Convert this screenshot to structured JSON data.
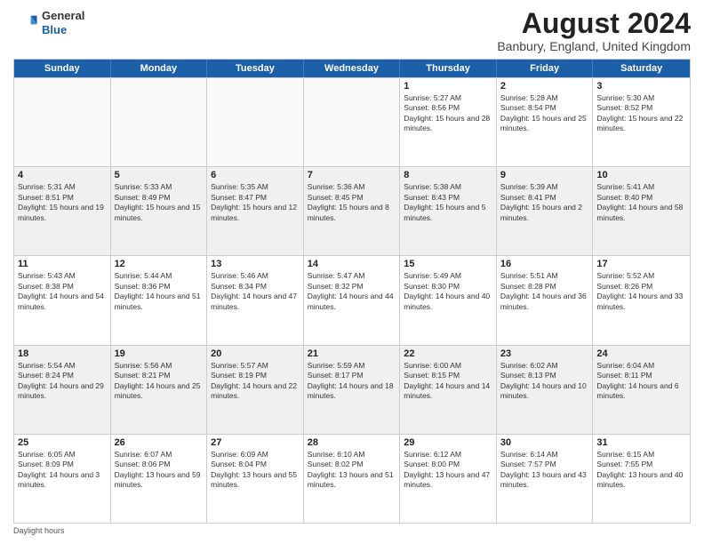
{
  "header": {
    "logo_general": "General",
    "logo_blue": "Blue",
    "month_title": "August 2024",
    "location": "Banbury, England, United Kingdom"
  },
  "days_of_week": [
    "Sunday",
    "Monday",
    "Tuesday",
    "Wednesday",
    "Thursday",
    "Friday",
    "Saturday"
  ],
  "weeks": [
    [
      {
        "day": "",
        "empty": true
      },
      {
        "day": "",
        "empty": true
      },
      {
        "day": "",
        "empty": true
      },
      {
        "day": "",
        "empty": true
      },
      {
        "day": "1",
        "sunrise": "5:27 AM",
        "sunset": "8:56 PM",
        "daylight": "15 hours and 28 minutes."
      },
      {
        "day": "2",
        "sunrise": "5:28 AM",
        "sunset": "8:54 PM",
        "daylight": "15 hours and 25 minutes."
      },
      {
        "day": "3",
        "sunrise": "5:30 AM",
        "sunset": "8:52 PM",
        "daylight": "15 hours and 22 minutes."
      }
    ],
    [
      {
        "day": "4",
        "sunrise": "5:31 AM",
        "sunset": "8:51 PM",
        "daylight": "15 hours and 19 minutes."
      },
      {
        "day": "5",
        "sunrise": "5:33 AM",
        "sunset": "8:49 PM",
        "daylight": "15 hours and 15 minutes."
      },
      {
        "day": "6",
        "sunrise": "5:35 AM",
        "sunset": "8:47 PM",
        "daylight": "15 hours and 12 minutes."
      },
      {
        "day": "7",
        "sunrise": "5:36 AM",
        "sunset": "8:45 PM",
        "daylight": "15 hours and 8 minutes."
      },
      {
        "day": "8",
        "sunrise": "5:38 AM",
        "sunset": "8:43 PM",
        "daylight": "15 hours and 5 minutes."
      },
      {
        "day": "9",
        "sunrise": "5:39 AM",
        "sunset": "8:41 PM",
        "daylight": "15 hours and 2 minutes."
      },
      {
        "day": "10",
        "sunrise": "5:41 AM",
        "sunset": "8:40 PM",
        "daylight": "14 hours and 58 minutes."
      }
    ],
    [
      {
        "day": "11",
        "sunrise": "5:43 AM",
        "sunset": "8:38 PM",
        "daylight": "14 hours and 54 minutes."
      },
      {
        "day": "12",
        "sunrise": "5:44 AM",
        "sunset": "8:36 PM",
        "daylight": "14 hours and 51 minutes."
      },
      {
        "day": "13",
        "sunrise": "5:46 AM",
        "sunset": "8:34 PM",
        "daylight": "14 hours and 47 minutes."
      },
      {
        "day": "14",
        "sunrise": "5:47 AM",
        "sunset": "8:32 PM",
        "daylight": "14 hours and 44 minutes."
      },
      {
        "day": "15",
        "sunrise": "5:49 AM",
        "sunset": "8:30 PM",
        "daylight": "14 hours and 40 minutes."
      },
      {
        "day": "16",
        "sunrise": "5:51 AM",
        "sunset": "8:28 PM",
        "daylight": "14 hours and 36 minutes."
      },
      {
        "day": "17",
        "sunrise": "5:52 AM",
        "sunset": "8:26 PM",
        "daylight": "14 hours and 33 minutes."
      }
    ],
    [
      {
        "day": "18",
        "sunrise": "5:54 AM",
        "sunset": "8:24 PM",
        "daylight": "14 hours and 29 minutes."
      },
      {
        "day": "19",
        "sunrise": "5:56 AM",
        "sunset": "8:21 PM",
        "daylight": "14 hours and 25 minutes."
      },
      {
        "day": "20",
        "sunrise": "5:57 AM",
        "sunset": "8:19 PM",
        "daylight": "14 hours and 22 minutes."
      },
      {
        "day": "21",
        "sunrise": "5:59 AM",
        "sunset": "8:17 PM",
        "daylight": "14 hours and 18 minutes."
      },
      {
        "day": "22",
        "sunrise": "6:00 AM",
        "sunset": "8:15 PM",
        "daylight": "14 hours and 14 minutes."
      },
      {
        "day": "23",
        "sunrise": "6:02 AM",
        "sunset": "8:13 PM",
        "daylight": "14 hours and 10 minutes."
      },
      {
        "day": "24",
        "sunrise": "6:04 AM",
        "sunset": "8:11 PM",
        "daylight": "14 hours and 6 minutes."
      }
    ],
    [
      {
        "day": "25",
        "sunrise": "6:05 AM",
        "sunset": "8:09 PM",
        "daylight": "14 hours and 3 minutes."
      },
      {
        "day": "26",
        "sunrise": "6:07 AM",
        "sunset": "8:06 PM",
        "daylight": "13 hours and 59 minutes."
      },
      {
        "day": "27",
        "sunrise": "6:09 AM",
        "sunset": "8:04 PM",
        "daylight": "13 hours and 55 minutes."
      },
      {
        "day": "28",
        "sunrise": "6:10 AM",
        "sunset": "8:02 PM",
        "daylight": "13 hours and 51 minutes."
      },
      {
        "day": "29",
        "sunrise": "6:12 AM",
        "sunset": "8:00 PM",
        "daylight": "13 hours and 47 minutes."
      },
      {
        "day": "30",
        "sunrise": "6:14 AM",
        "sunset": "7:57 PM",
        "daylight": "13 hours and 43 minutes."
      },
      {
        "day": "31",
        "sunrise": "6:15 AM",
        "sunset": "7:55 PM",
        "daylight": "13 hours and 40 minutes."
      }
    ]
  ],
  "footer": {
    "note": "Daylight hours"
  }
}
